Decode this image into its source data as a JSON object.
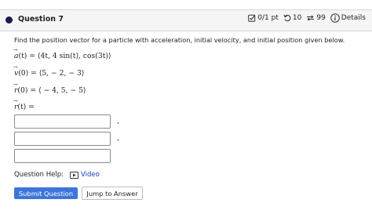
{
  "header": {
    "title": "Question 7",
    "score": "0/1 pt",
    "retries": "10",
    "attempts": "99",
    "details_label": "Details",
    "icons": [
      "circle-dot-icon",
      "checkbox-icon",
      "undo-icon",
      "retry-icon",
      "info-icon"
    ]
  },
  "question": {
    "prompt": "Find the position vector for a particle with acceleration, initial velocity, and initial position given below.",
    "accel": {
      "name": "a",
      "rhs": "(t) = ⟨4t, 4 sin(t), cos(3t)⟩"
    },
    "velocity": {
      "name": "v",
      "rhs": "(0) = ⟨5,  − 2,  − 3⟩"
    },
    "position": {
      "name": "r",
      "rhs": "(0) = ⟨ − 4, 5,  − 5⟩"
    },
    "answer_label": {
      "name": "r",
      "rhs": "(t) ="
    }
  },
  "answers": [
    {
      "value": "",
      "separator": ","
    },
    {
      "value": "",
      "separator": ","
    },
    {
      "value": "",
      "separator": ""
    }
  ],
  "help": {
    "label": "Question Help:",
    "video_label": "Video"
  },
  "buttons": {
    "submit": "Submit Question",
    "jump": "Jump to Answer"
  },
  "colors": {
    "primary": "#3d75db",
    "link": "#1a3fbf",
    "header_bg": "#f5f5f5",
    "dot": "#1a1a4e"
  }
}
